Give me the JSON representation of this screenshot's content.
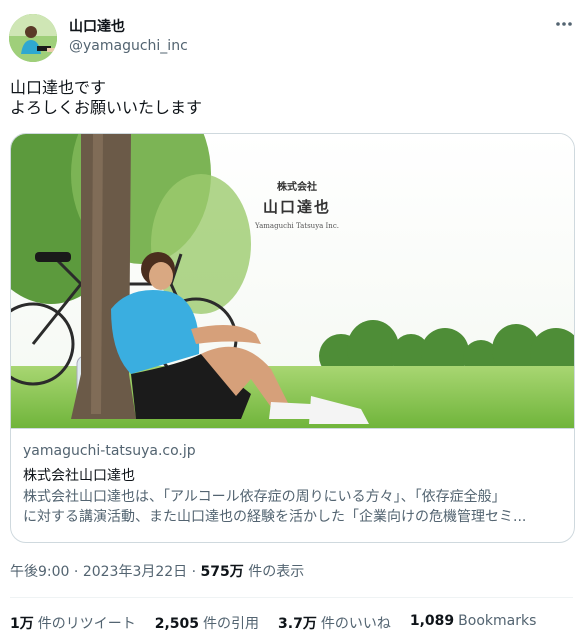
{
  "author": {
    "display_name": "山口達也",
    "handle": "@yamaguchi_inc"
  },
  "more_icon": "more-horizontal-icon",
  "tweet": {
    "lines": [
      "山口達也です",
      "よろしくお願いいたします"
    ]
  },
  "card": {
    "image_overlay": {
      "company_label": "株式会社",
      "company_name": "山口達也",
      "company_roman": "Yamaguchi Tatsuya Inc."
    },
    "domain": "yamaguchi-tatsuya.co.jp",
    "title": "株式会社山口達也",
    "description_lines": [
      "株式会社山口達也は、「アルコール依存症の周りにいる方々」、「依存症全般」",
      "に対する講演活動、また山口達也の経験を活かした「企業向けの危機管理セミ..."
    ]
  },
  "meta": {
    "time": "午後9:00",
    "separator": "·",
    "date": "2023年3月22日",
    "views_count": "575万",
    "views_label": "件の表示"
  },
  "stats": [
    {
      "count": "1万",
      "label": "件のリツイート"
    },
    {
      "count": "2,505",
      "label": "件の引用"
    },
    {
      "count": "3.7万",
      "label": "件のいいね"
    },
    {
      "count": "1,089",
      "label": "Bookmarks"
    }
  ],
  "colors": {
    "text_primary": "#0f1419",
    "text_secondary": "#536471",
    "border": "#cfd9de"
  }
}
